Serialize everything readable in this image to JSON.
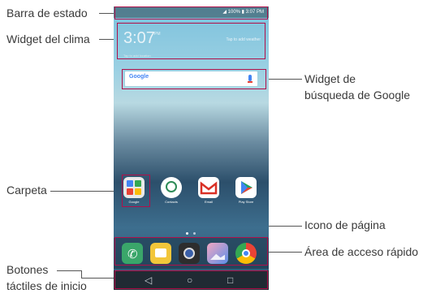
{
  "callouts": {
    "status_bar": "Barra de estado",
    "weather_widget": "Widget del clima",
    "google_widget_1": "Widget de",
    "google_widget_2": "búsqueda de Google",
    "folder": "Carpeta",
    "page_icon": "Icono de página",
    "quick_access": "Área de acceso rápido",
    "home_buttons_1": "Botones",
    "home_buttons_2": "táctiles de inicio"
  },
  "phone": {
    "status_text": "◢ 100% ▮ 3:07 PM",
    "clock": "3:07",
    "clock_sub": "PM",
    "weather_tap": "Tap to add weather",
    "weather_line": "Tap to add location",
    "search_logo": "Google",
    "apps": [
      {
        "label": "Google",
        "color": "#e8e8e8",
        "icon": "folder-icon"
      },
      {
        "label": "Contacts",
        "color": "#ffffff",
        "icon": "contacts-icon"
      },
      {
        "label": "Email",
        "color": "#ffffff",
        "icon": "gmail-icon"
      },
      {
        "label": "Play Store",
        "color": "#ffffff",
        "icon": "play-store-icon"
      }
    ],
    "dock": [
      {
        "icon": "phone-icon",
        "color": "#3aa66a"
      },
      {
        "icon": "messages-icon",
        "color": "#f2c63a"
      },
      {
        "icon": "camera-icon",
        "color": "#2d2d2d"
      },
      {
        "icon": "gallery-icon",
        "color": "#e06a8a"
      },
      {
        "icon": "chrome-icon",
        "color": "#ffffff"
      }
    ],
    "nav": {
      "back": "◁",
      "home": "○",
      "recent": "□"
    }
  }
}
